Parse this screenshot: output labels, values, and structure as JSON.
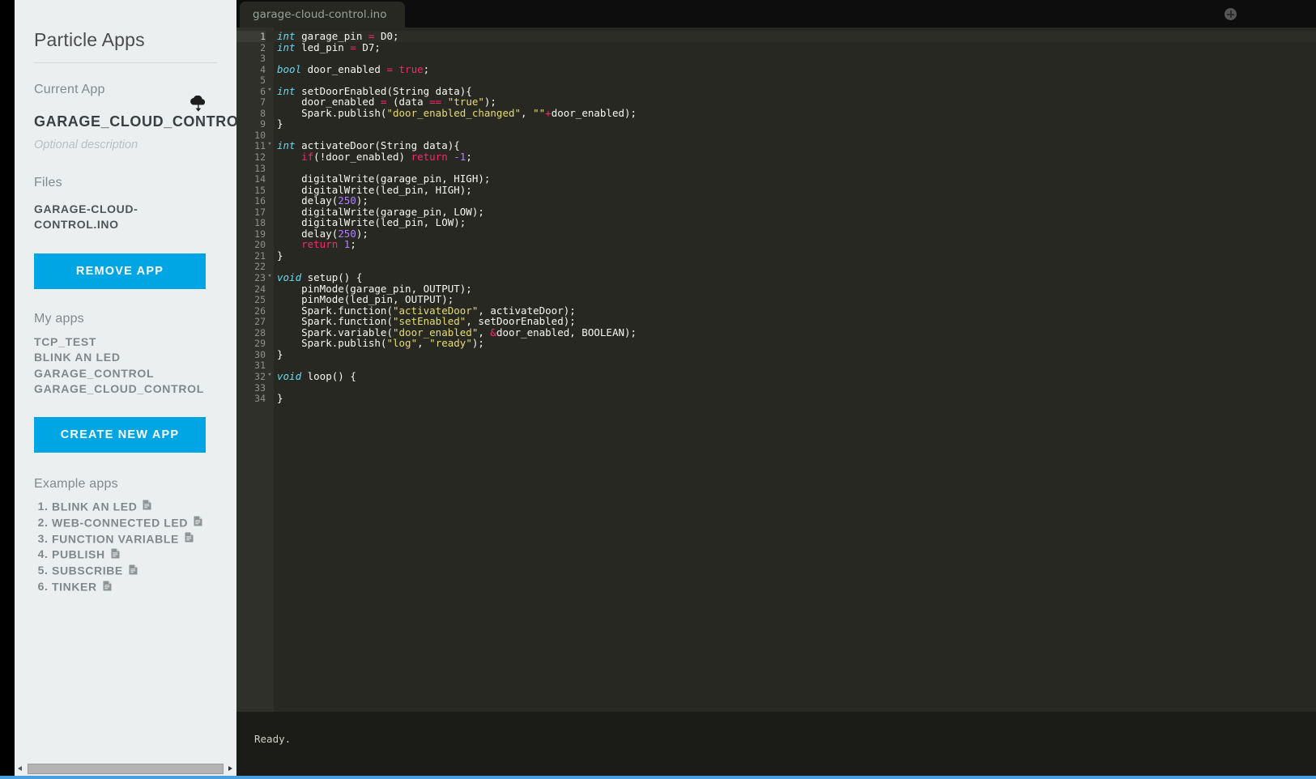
{
  "sidebar": {
    "title": "Particle Apps",
    "current_app_label": "Current App",
    "current_app_name": "GARAGE_CLOUD_CONTROL",
    "cloud_icon": "cloud-download-icon",
    "optional_description": "Optional description",
    "files_label": "Files",
    "file_name": "GARAGE-CLOUD-CONTROL.INO",
    "remove_app_label": "REMOVE APP",
    "my_apps_label": "My apps",
    "my_apps": [
      "TCP_TEST",
      "BLINK AN LED",
      "GARAGE_CONTROL",
      "GARAGE_CLOUD_CONTROL"
    ],
    "create_new_app_label": "CREATE NEW APP",
    "example_apps_label": "Example apps",
    "example_apps": [
      "BLINK AN LED",
      "WEB-CONNECTED LED",
      "FUNCTION VARIABLE",
      "PUBLISH",
      "SUBSCRIBE",
      "TINKER"
    ],
    "doc_icon": "document-icon",
    "accent_color": "#00a6e4",
    "background_color": "#eceff0"
  },
  "scrollbar": {
    "left_arrow_icon": "arrow-left-icon",
    "right_arrow_icon": "arrow-right-icon"
  },
  "editor": {
    "tab_label": "garage-cloud-control.ino",
    "add_tab_icon": "plus-circle-icon",
    "background_color": "#272822",
    "gutter_color": "#2f302a",
    "active_line": 1,
    "total_lines": 34,
    "lines": [
      {
        "n": 1,
        "fold": "",
        "tokens": [
          [
            "t-kw",
            "int"
          ],
          [
            "t-pl",
            " garage_pin "
          ],
          [
            "t-op",
            "="
          ],
          [
            "t-pl",
            " D0;"
          ]
        ]
      },
      {
        "n": 2,
        "fold": "",
        "tokens": [
          [
            "t-kw",
            "int"
          ],
          [
            "t-pl",
            " led_pin "
          ],
          [
            "t-op",
            "="
          ],
          [
            "t-pl",
            " D7;"
          ]
        ]
      },
      {
        "n": 3,
        "fold": "",
        "tokens": []
      },
      {
        "n": 4,
        "fold": "",
        "tokens": [
          [
            "t-kw",
            "bool"
          ],
          [
            "t-pl",
            " door_enabled "
          ],
          [
            "t-op",
            "="
          ],
          [
            "t-pl",
            " "
          ],
          [
            "t-ctl",
            "true"
          ],
          [
            "t-pl",
            ";"
          ]
        ]
      },
      {
        "n": 5,
        "fold": "",
        "tokens": []
      },
      {
        "n": 6,
        "fold": "▾",
        "tokens": [
          [
            "t-kw",
            "int"
          ],
          [
            "t-pl",
            " setDoorEnabled(String data){"
          ]
        ]
      },
      {
        "n": 7,
        "fold": "",
        "tokens": [
          [
            "t-pl",
            "    door_enabled "
          ],
          [
            "t-op",
            "="
          ],
          [
            "t-pl",
            " (data "
          ],
          [
            "t-op",
            "=="
          ],
          [
            "t-pl",
            " "
          ],
          [
            "t-str",
            "\"true\""
          ],
          [
            "t-pl",
            ");"
          ]
        ]
      },
      {
        "n": 8,
        "fold": "",
        "tokens": [
          [
            "t-pl",
            "    Spark.publish("
          ],
          [
            "t-str",
            "\"door_enabled_changed\""
          ],
          [
            "t-pl",
            ", "
          ],
          [
            "t-str",
            "\"\""
          ],
          [
            "t-op",
            "+"
          ],
          [
            "t-pl",
            "door_enabled);"
          ]
        ]
      },
      {
        "n": 9,
        "fold": "",
        "tokens": [
          [
            "t-pl",
            "}"
          ]
        ]
      },
      {
        "n": 10,
        "fold": "",
        "tokens": []
      },
      {
        "n": 11,
        "fold": "▾",
        "tokens": [
          [
            "t-kw",
            "int"
          ],
          [
            "t-pl",
            " activateDoor(String data){"
          ]
        ]
      },
      {
        "n": 12,
        "fold": "",
        "tokens": [
          [
            "t-pl",
            "    "
          ],
          [
            "t-ctl",
            "if"
          ],
          [
            "t-pl",
            "(!door_enabled) "
          ],
          [
            "t-ctl",
            "return"
          ],
          [
            "t-pl",
            " "
          ],
          [
            "t-num",
            "-1"
          ],
          [
            "t-pl",
            ";"
          ]
        ]
      },
      {
        "n": 13,
        "fold": "",
        "tokens": []
      },
      {
        "n": 14,
        "fold": "",
        "tokens": [
          [
            "t-pl",
            "    digitalWrite(garage_pin, HIGH);"
          ]
        ]
      },
      {
        "n": 15,
        "fold": "",
        "tokens": [
          [
            "t-pl",
            "    digitalWrite(led_pin, HIGH);"
          ]
        ]
      },
      {
        "n": 16,
        "fold": "",
        "tokens": [
          [
            "t-pl",
            "    delay("
          ],
          [
            "t-num",
            "250"
          ],
          [
            "t-pl",
            ");"
          ]
        ]
      },
      {
        "n": 17,
        "fold": "",
        "tokens": [
          [
            "t-pl",
            "    digitalWrite(garage_pin, LOW);"
          ]
        ]
      },
      {
        "n": 18,
        "fold": "",
        "tokens": [
          [
            "t-pl",
            "    digitalWrite(led_pin, LOW);"
          ]
        ]
      },
      {
        "n": 19,
        "fold": "",
        "tokens": [
          [
            "t-pl",
            "    delay("
          ],
          [
            "t-num",
            "250"
          ],
          [
            "t-pl",
            ");"
          ]
        ]
      },
      {
        "n": 20,
        "fold": "",
        "tokens": [
          [
            "t-pl",
            "    "
          ],
          [
            "t-ctl",
            "return"
          ],
          [
            "t-pl",
            " "
          ],
          [
            "t-num",
            "1"
          ],
          [
            "t-pl",
            ";"
          ]
        ]
      },
      {
        "n": 21,
        "fold": "",
        "tokens": [
          [
            "t-pl",
            "}"
          ]
        ]
      },
      {
        "n": 22,
        "fold": "",
        "tokens": []
      },
      {
        "n": 23,
        "fold": "▾",
        "tokens": [
          [
            "t-kw",
            "void"
          ],
          [
            "t-pl",
            " setup() {"
          ]
        ]
      },
      {
        "n": 24,
        "fold": "",
        "tokens": [
          [
            "t-pl",
            "    pinMode(garage_pin, OUTPUT);"
          ]
        ]
      },
      {
        "n": 25,
        "fold": "",
        "tokens": [
          [
            "t-pl",
            "    pinMode(led_pin, OUTPUT);"
          ]
        ]
      },
      {
        "n": 26,
        "fold": "",
        "tokens": [
          [
            "t-pl",
            "    Spark.function("
          ],
          [
            "t-str",
            "\"activateDoor\""
          ],
          [
            "t-pl",
            ", activateDoor);"
          ]
        ]
      },
      {
        "n": 27,
        "fold": "",
        "tokens": [
          [
            "t-pl",
            "    Spark.function("
          ],
          [
            "t-str",
            "\"setEnabled\""
          ],
          [
            "t-pl",
            ", setDoorEnabled);"
          ]
        ]
      },
      {
        "n": 28,
        "fold": "",
        "tokens": [
          [
            "t-pl",
            "    Spark.variable("
          ],
          [
            "t-str",
            "\"door_enabled\""
          ],
          [
            "t-pl",
            ", "
          ],
          [
            "t-op",
            "&"
          ],
          [
            "t-pl",
            "door_enabled, BOOLEAN);"
          ]
        ]
      },
      {
        "n": 29,
        "fold": "",
        "tokens": [
          [
            "t-pl",
            "    Spark.publish("
          ],
          [
            "t-str",
            "\"log\""
          ],
          [
            "t-pl",
            ", "
          ],
          [
            "t-str",
            "\"ready\""
          ],
          [
            "t-pl",
            ");"
          ]
        ]
      },
      {
        "n": 30,
        "fold": "",
        "tokens": [
          [
            "t-pl",
            "}"
          ]
        ]
      },
      {
        "n": 31,
        "fold": "",
        "tokens": []
      },
      {
        "n": 32,
        "fold": "▾",
        "tokens": [
          [
            "t-kw",
            "void"
          ],
          [
            "t-pl",
            " loop() {"
          ]
        ]
      },
      {
        "n": 33,
        "fold": "",
        "tokens": []
      },
      {
        "n": 34,
        "fold": "",
        "tokens": [
          [
            "t-pl",
            "}"
          ]
        ]
      }
    ]
  },
  "status": {
    "message": "Ready."
  }
}
